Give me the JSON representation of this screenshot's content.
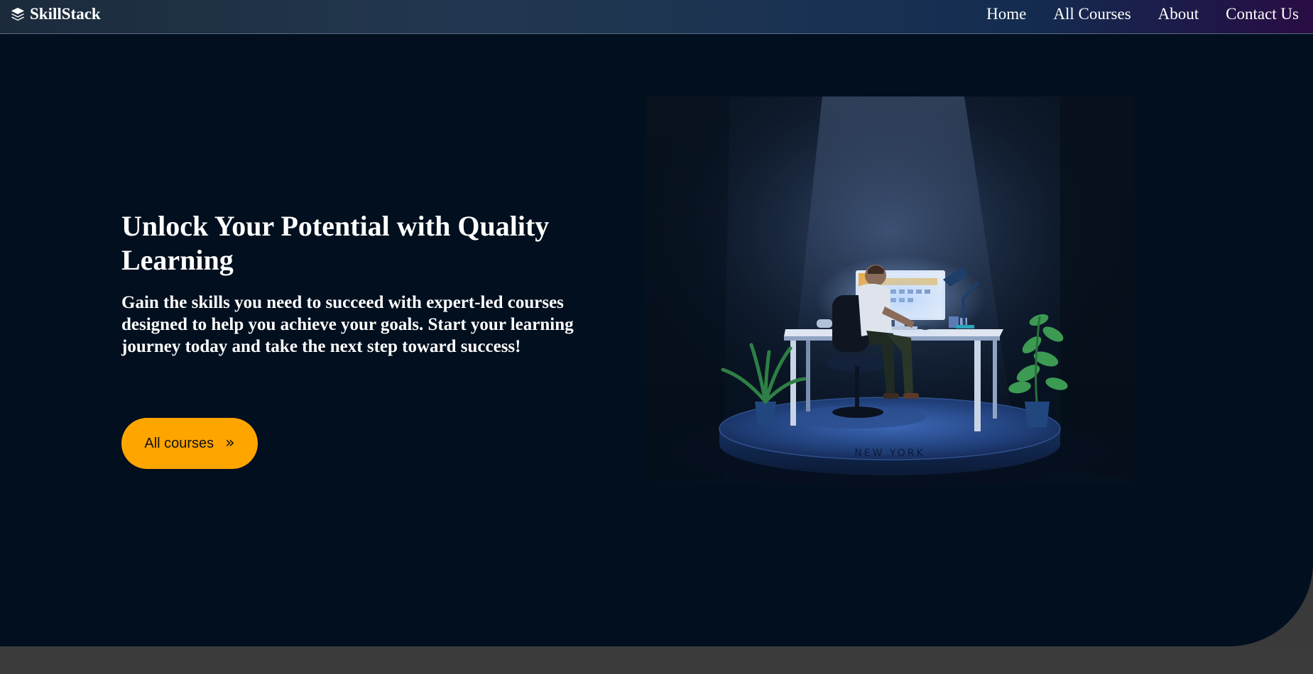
{
  "brand": {
    "name": "SkillStack",
    "icon": "layers-icon"
  },
  "nav": {
    "links": [
      "Home",
      "All Courses",
      "About",
      "Contact Us"
    ]
  },
  "hero": {
    "title": "Unlock Your Potential with Quality Learning",
    "subtitle": "Gain the skills you need to succeed with expert-led courses designed to help you achieve your goals. Start your learning journey today and take the next step toward success!",
    "cta_label": "All courses",
    "cta_icon": "double-chevron-right-icon",
    "cta_glyph": "»",
    "illustration_caption": "NEW YORK"
  },
  "colors": {
    "hero_bg": "#010f1e",
    "accent": "#ffa500",
    "footer_strip": "#3b3b3b"
  }
}
